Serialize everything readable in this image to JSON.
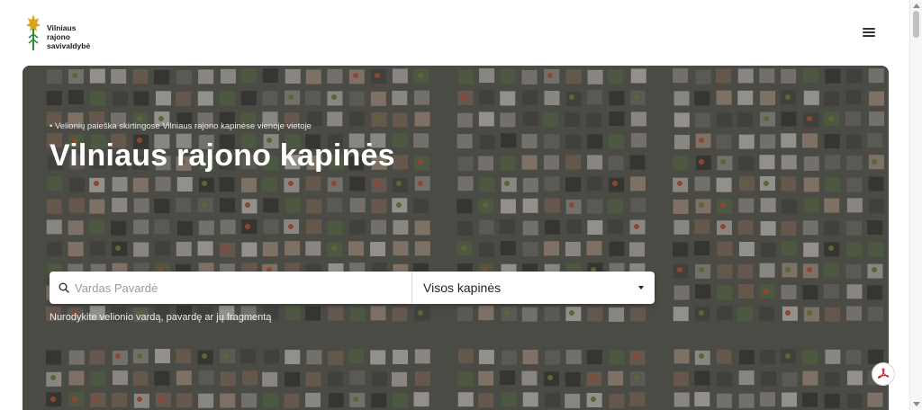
{
  "header": {
    "logo_lines": [
      "Vilniaus",
      "rajono",
      "savivaldybė"
    ],
    "logo_icon": "coat-of-arms-icon",
    "menu_icon": "hamburger-menu-icon"
  },
  "hero": {
    "subtitle": "• Velionių paieška skirtingose Vilniaus rajono kapinėse vienoje vietoje",
    "title": "Vilniaus rajono kapinės",
    "search": {
      "placeholder": "Vardas Pavardė",
      "value": ""
    },
    "select": {
      "selected": "Visos kapinės"
    },
    "hint": "Nurodykite velionio vardą, pavardę ar jų fragmentą"
  },
  "floating": {
    "pdf_icon": "pdf-icon"
  },
  "colors": {
    "logo_gold": "#d9a51c",
    "logo_green": "#2e8b3c",
    "pdf_red": "#c62828"
  }
}
